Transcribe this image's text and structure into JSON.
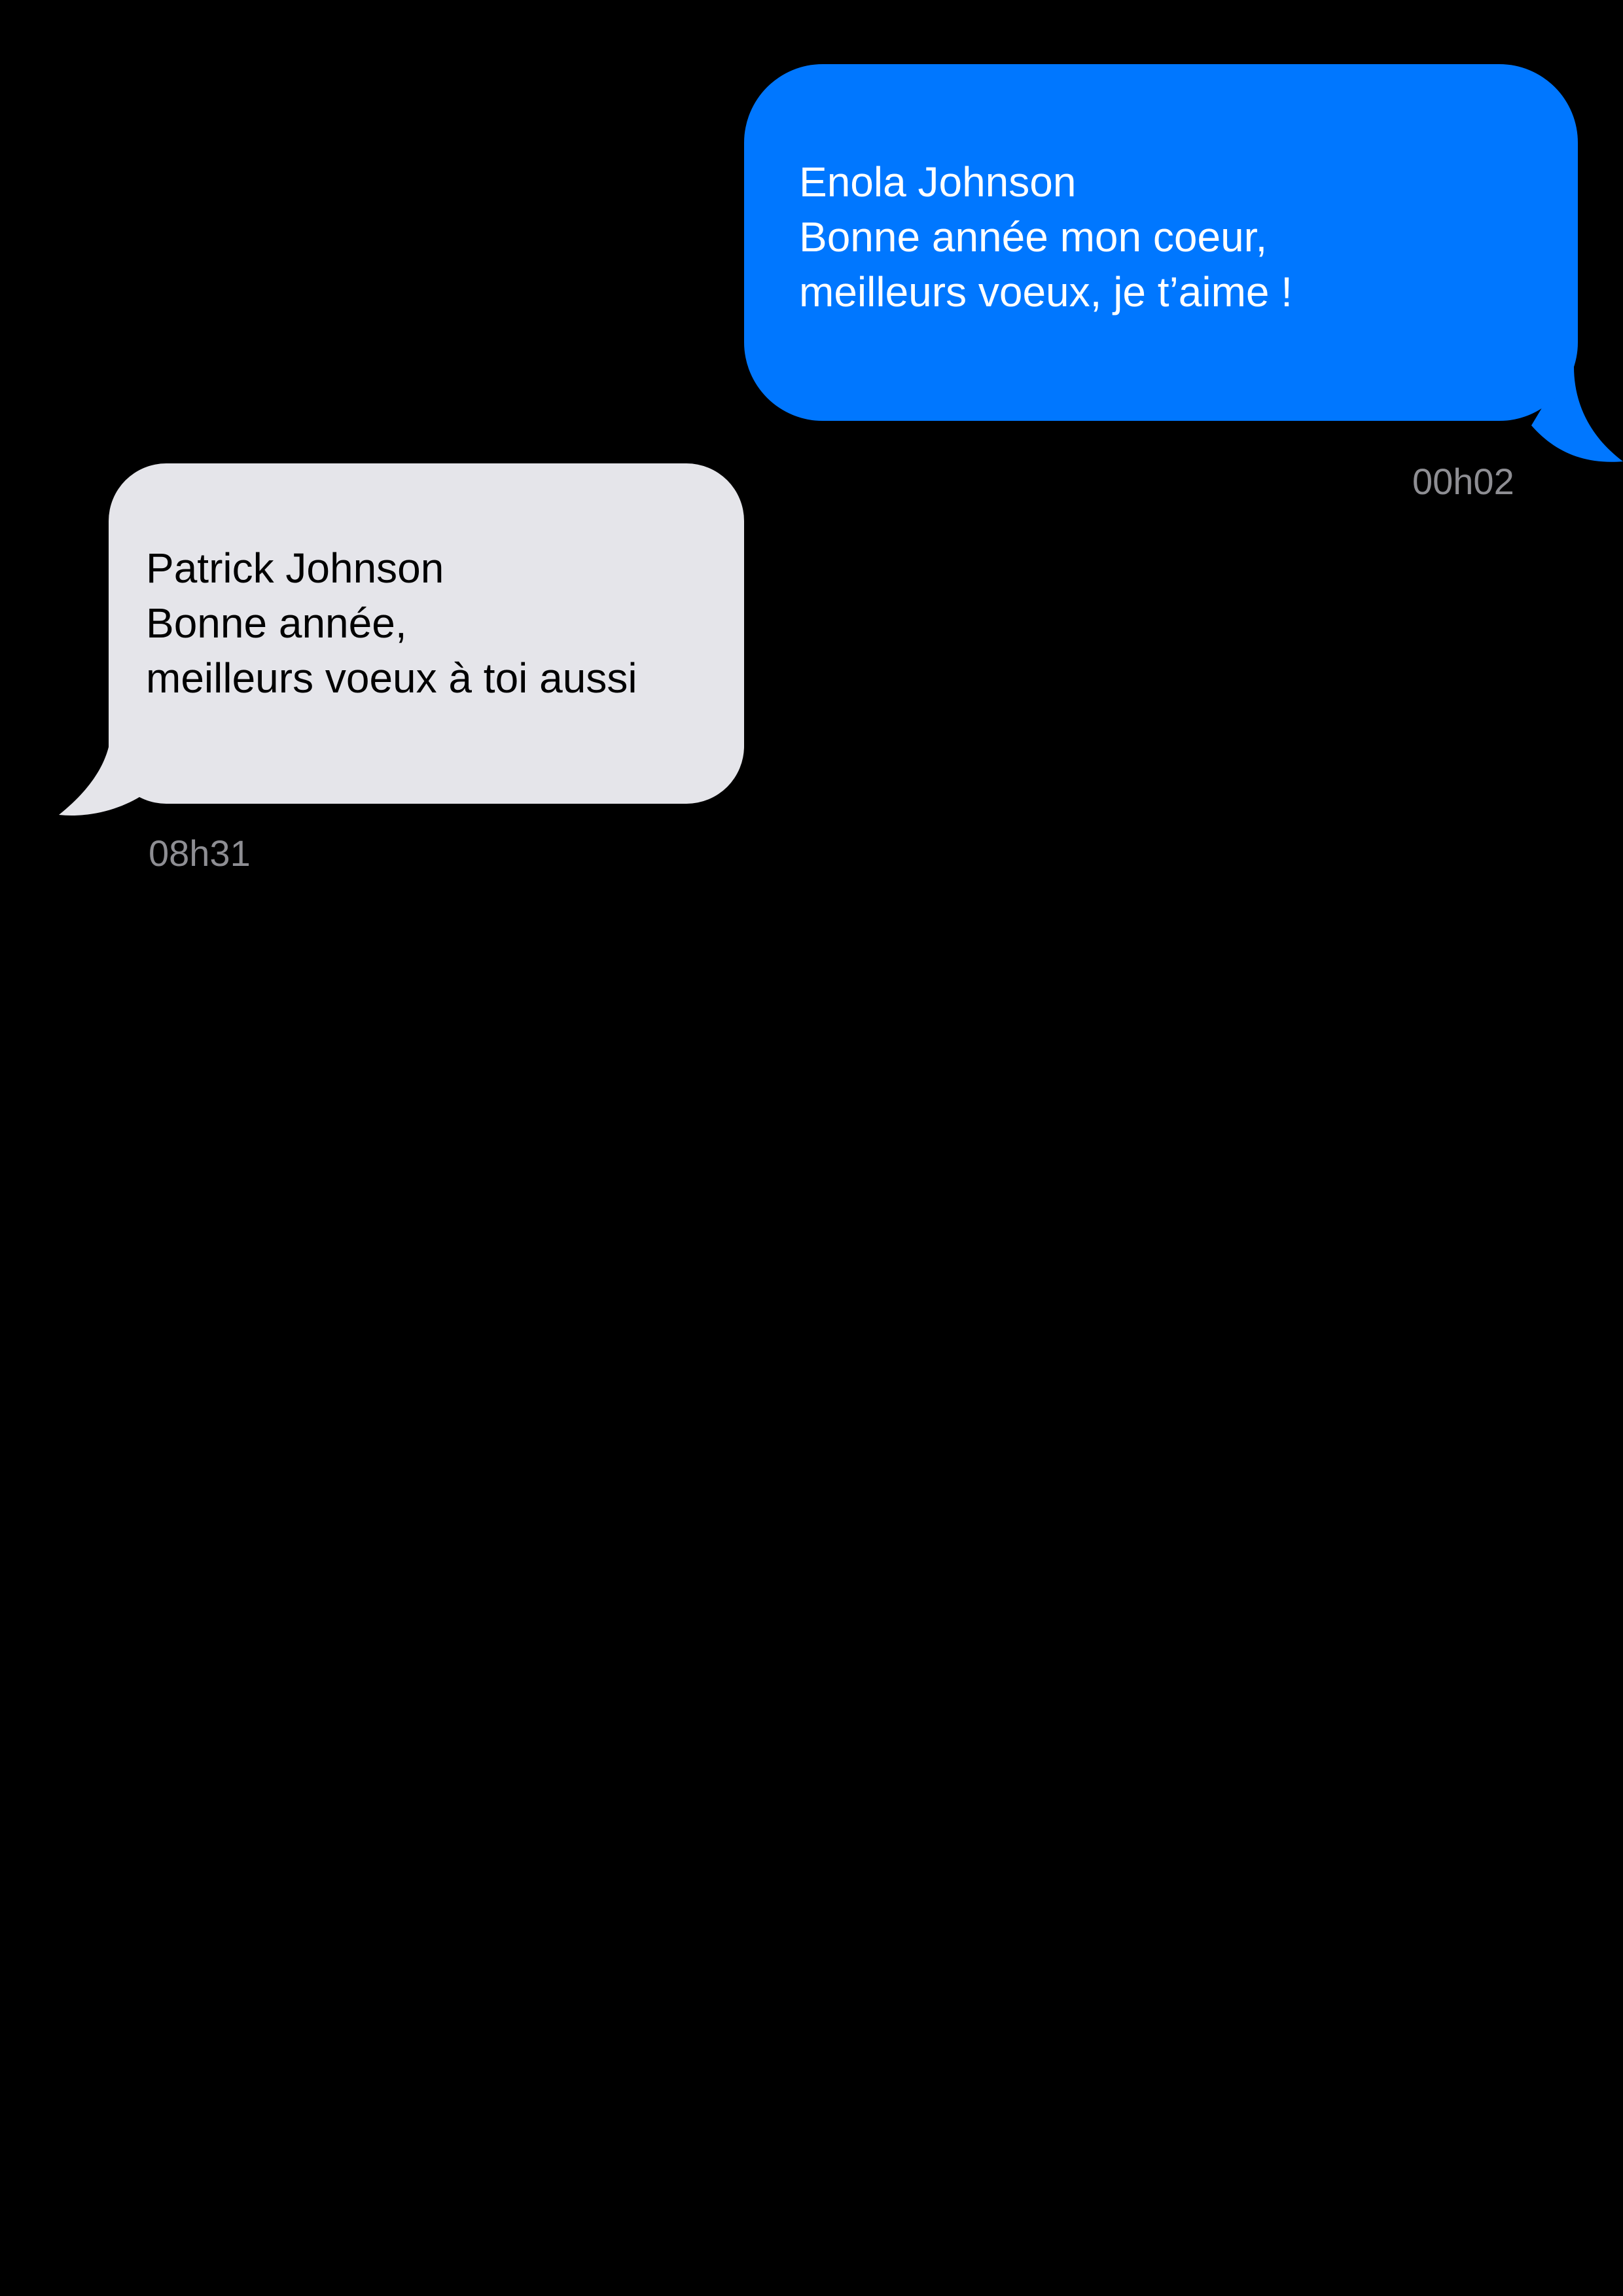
{
  "messages": [
    {
      "direction": "sent",
      "sender": "Enola Johnson",
      "lines": [
        "Bonne année mon coeur,",
        "meilleurs voeux, je t’aime !"
      ],
      "time": "00h02",
      "bubble_color": "#0077FF",
      "text_color": "#FFFFFF"
    },
    {
      "direction": "received",
      "sender": "Patrick Johnson",
      "lines": [
        "Bonne année,",
        "meilleurs voeux à toi aussi"
      ],
      "time": "08h31",
      "bubble_color": "#E5E5EA",
      "text_color": "#000000"
    }
  ],
  "colors": {
    "background": "#000000",
    "timestamp": "#8E8E93"
  }
}
